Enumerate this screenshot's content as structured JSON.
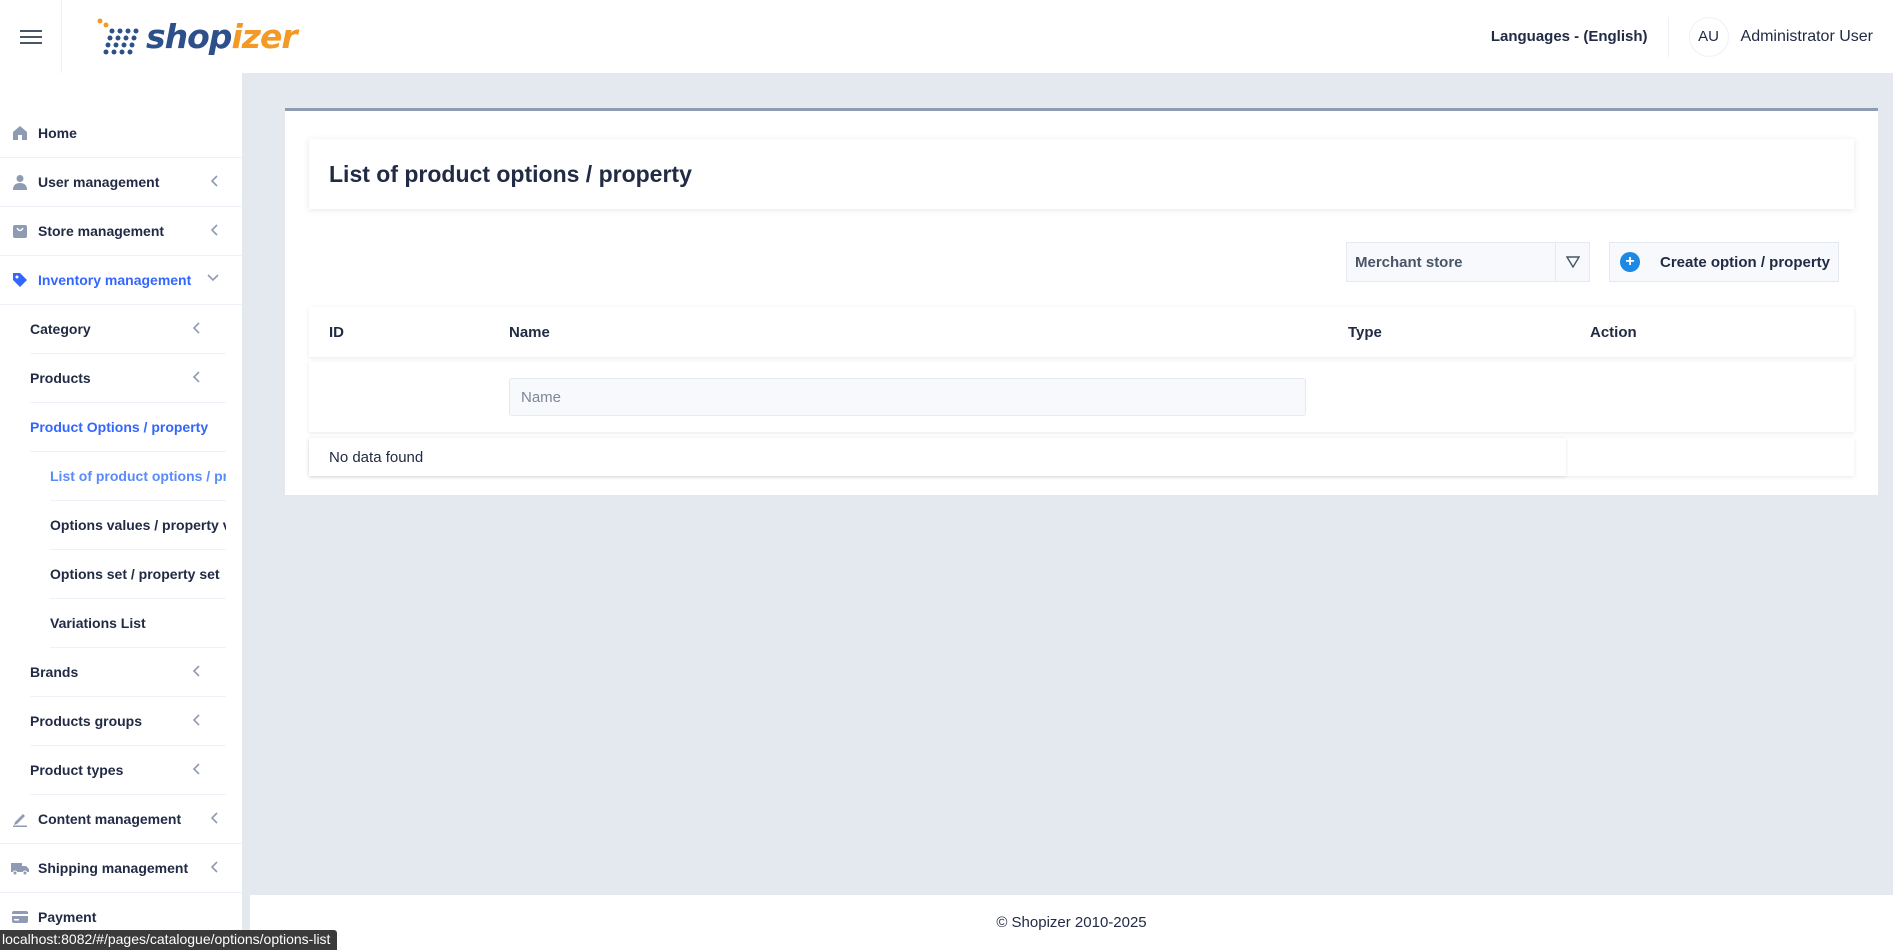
{
  "header": {
    "menu_icon": "hamburger-icon",
    "logo_text_a": "shop",
    "logo_text_b": "izer",
    "languages": "Languages - (English)",
    "avatar_initials": "AU",
    "user_name": "Administrator User"
  },
  "sidebar": {
    "home": "Home",
    "user_management": "User management",
    "store_management": "Store management",
    "inventory_management": "Inventory management",
    "category": "Category",
    "products": "Products",
    "product_options": "Product Options / property",
    "list_options": "List of product options / pr",
    "options_values": "Options values / property v",
    "options_set": "Options set / property set",
    "variations_list": "Variations List",
    "brands": "Brands",
    "products_groups": "Products groups",
    "product_types": "Product types",
    "content_management": "Content management",
    "shipping_management": "Shipping management",
    "payment": "Payment"
  },
  "main": {
    "title": "List of product options / property",
    "merchant_select": "Merchant store",
    "create_button": "Create option / property",
    "columns": {
      "id": "ID",
      "name": "Name",
      "type": "Type",
      "action": "Action"
    },
    "name_filter_placeholder": "Name",
    "empty_message": "No data found"
  },
  "footer": {
    "copyright": "© Shopizer 2010-2025"
  },
  "status_bar": {
    "url": "localhost:8082/#/pages/catalogue/options/options-list"
  },
  "colors": {
    "accent": "#3366ff",
    "accent_light": "#598bff",
    "logo_blue": "#2d4f8a",
    "logo_orange": "#f29a25"
  }
}
